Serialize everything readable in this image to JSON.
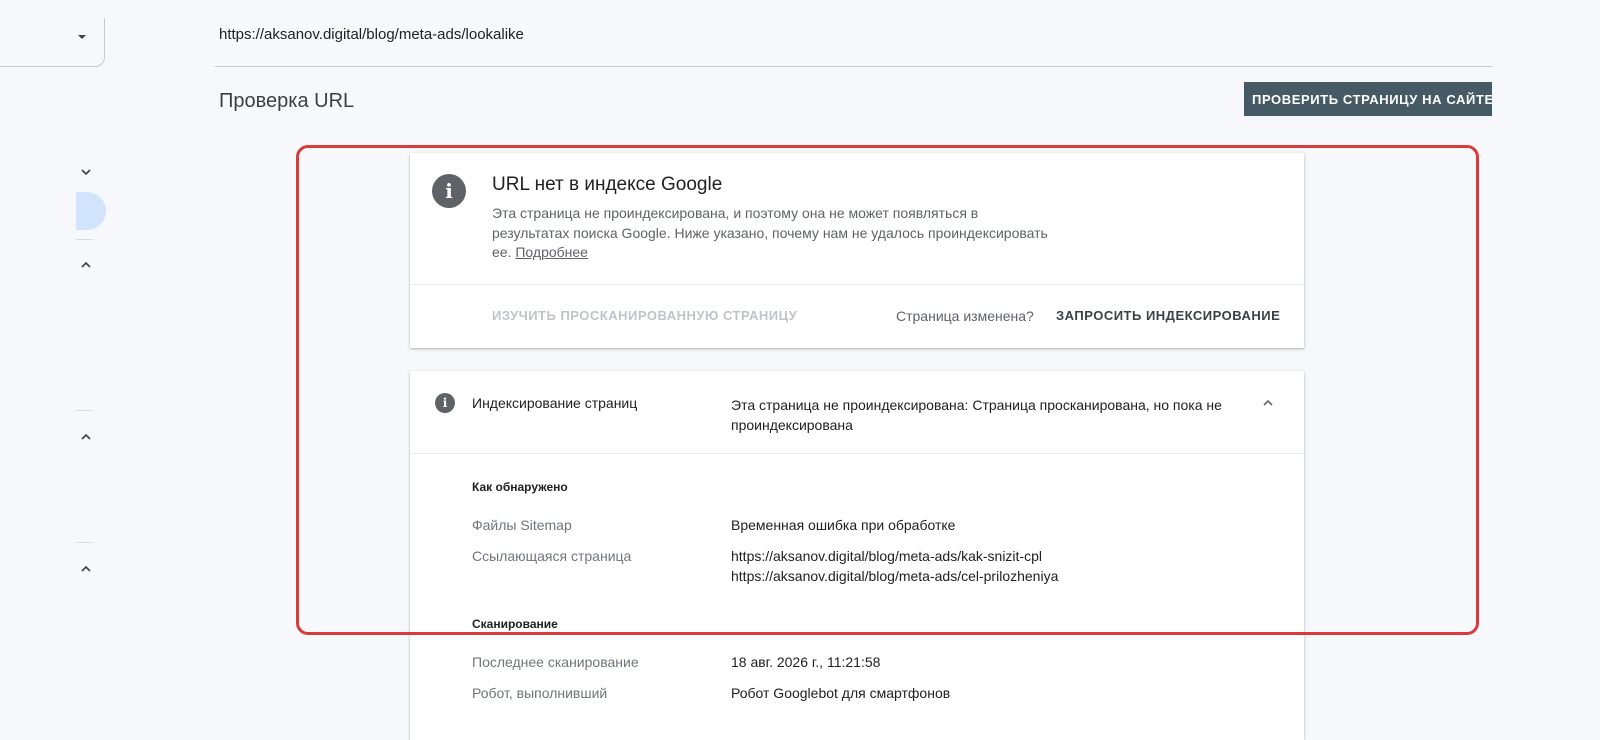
{
  "url_bar": {
    "url": "https://aksanov.digital/blog/meta-ads/lookalike"
  },
  "header": {
    "title": "Проверка URL",
    "test_live_button": "ПРОВЕРИТЬ СТРАНИЦУ НА САЙТЕ"
  },
  "status_card": {
    "title": "URL нет в индексе Google",
    "description": "Эта страница не проиндексирована, и поэтому она не может появляться в результатах поиска Google. Ниже указано, почему нам не удалось проиндексировать ее.",
    "learn_more": "Подробнее",
    "view_crawled_button": "ИЗУЧИТЬ ПРОСКАНИРОВАННУЮ СТРАНИЦУ",
    "page_changed_text": "Страница изменена?",
    "request_indexing_button": "ЗАПРОСИТЬ ИНДЕКСИРОВАНИЕ"
  },
  "indexing_card": {
    "label": "Индексирование страниц",
    "status": "Эта страница не проиндексирована: Страница просканирована, но пока не проиндексирована",
    "discovery": {
      "heading": "Как обнаружено",
      "sitemaps_label": "Файлы Sitemap",
      "sitemaps_value": "Временная ошибка при обработке",
      "referring_label": "Ссылающаяся страница",
      "referring_pages": [
        "https://aksanov.digital/blog/meta-ads/kak-snizit-cpl",
        "https://aksanov.digital/blog/meta-ads/cel-prilozheniya"
      ]
    },
    "crawl": {
      "heading": "Сканирование",
      "last_crawl_label": "Последнее сканирование",
      "last_crawl_value": "18 авг. 2026 г., 11:21:58",
      "crawled_as_label": "Робот, выполнивший",
      "crawled_as_value": "Робот Googlebot для смартфонов"
    }
  },
  "colors": {
    "primary_button": "#455a64",
    "highlight_border": "#d93b3b",
    "selected_nav": "#d2e3fc"
  }
}
